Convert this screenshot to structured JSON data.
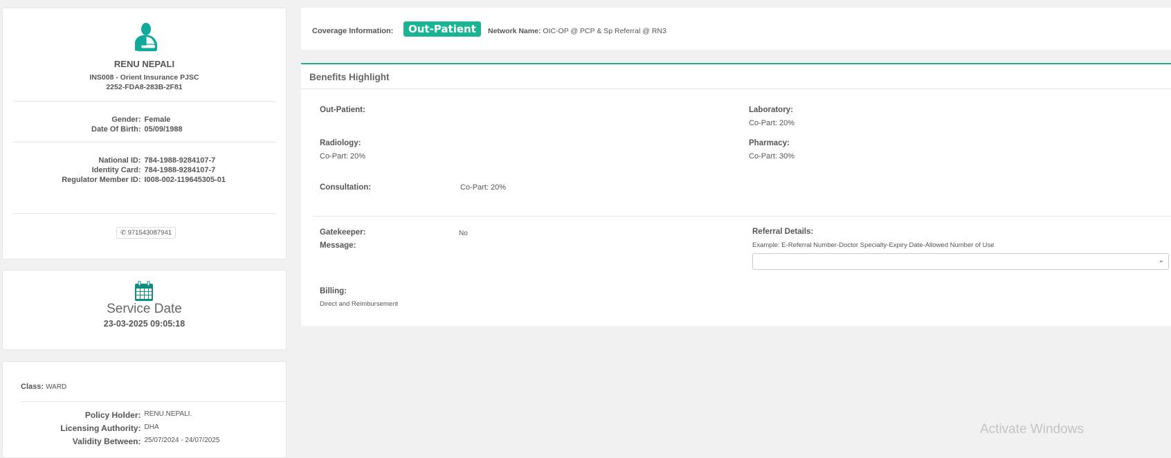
{
  "member": {
    "name": "RENU NEPALI",
    "insurer": "INS008 - Orient Insurance PJSC",
    "card_id": "2252-FDA8-283B-2F81",
    "gender_label": "Gender:",
    "gender": "Female",
    "dob_label": "Date Of Birth:",
    "dob": "05/09/1988",
    "national_id_label": "National ID:",
    "national_id": "784-1988-9284107-7",
    "identity_card_label": "Identity Card:",
    "identity_card": "784-1988-9284107-7",
    "regulator_label": "Regulator Member ID:",
    "regulator_id": "I008-002-119645305-01",
    "phone": "971543087941"
  },
  "service": {
    "title": "Service Date",
    "datetime": "23-03-2025 09:05:18"
  },
  "policy": {
    "class_label": "Class:",
    "class": "WARD",
    "holder_label": "Policy Holder:",
    "holder": "RENU.NEPALI.",
    "authority_label": "Licensing Authority:",
    "authority": "DHA",
    "validity_label": "Validity Between:",
    "validity": "25/07/2024 - 24/07/2025"
  },
  "coverage": {
    "label": "Coverage Information:",
    "badge": "Out-Patient",
    "network_label": "Network Name:",
    "network": "OIC-OP @ PCP & Sp Referral @ RN3"
  },
  "benefits": {
    "title": "Benefits Highlight",
    "outpatient": "Out-Patient:",
    "laboratory": "Laboratory:",
    "laboratory_value": "Co-Part: 20%",
    "radiology": "Radiology:",
    "radiology_value": "Co-Part: 20%",
    "pharmacy": "Pharmacy:",
    "pharmacy_value": "Co-Part: 30%",
    "consultation": "Consultation:",
    "consultation_value": "Co-Part: 20%",
    "gatekeeper": "Gatekeeper:",
    "gatekeeper_value": "No",
    "message": "Message:",
    "referral": "Referral Details:",
    "referral_example": "Example: E-Referral Number-Doctor Specialty-Expiry Date-Allowed Number of Use",
    "billing": "Billing:",
    "billing_value": "Direct and Reimbursement"
  },
  "watermark": "Activate Windows",
  "colors": {
    "accent": "#1ab394",
    "icon": "#0e9e8e"
  }
}
